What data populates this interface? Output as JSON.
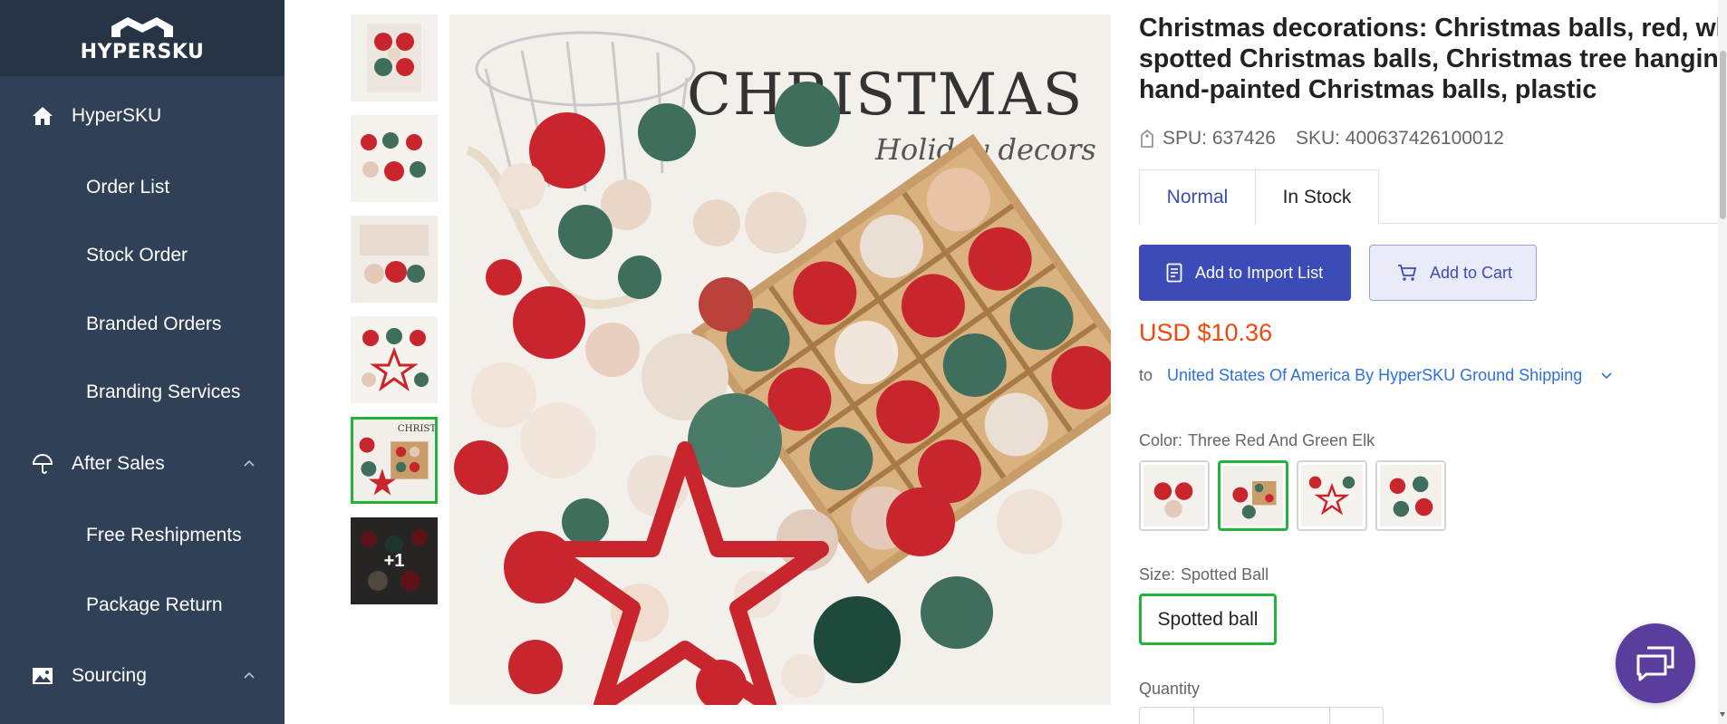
{
  "brand": {
    "name": "HYPERSKU"
  },
  "sidebar": {
    "home_group": {
      "label": "HyperSKU",
      "icon": "home-icon"
    },
    "home_items": [
      "Order List",
      "Stock Order",
      "Branded Orders",
      "Branding Services"
    ],
    "after_sales_group": {
      "label": "After Sales",
      "icon": "umbrella-icon"
    },
    "after_sales_items": [
      "Free Reshipments",
      "Package Return"
    ],
    "sourcing_group": {
      "label": "Sourcing",
      "icon": "image-icon"
    }
  },
  "gallery": {
    "more_count_label": "+1",
    "image_text": {
      "headline": "CHRISTMAS",
      "script": "Holiday decors"
    }
  },
  "product": {
    "title_line1": "Christmas decorations: Christmas balls, red, white",
    "title_line2": "spotted Christmas balls, Christmas tree hanging",
    "title_line3": "hand-painted Christmas balls, plastic",
    "spu": "SPU: 637426",
    "sku": "SKU: 400637426100012",
    "tabs": [
      "Normal",
      "In Stock"
    ],
    "add_to_import_label": "Add to Import List",
    "add_to_cart_label": "Add to Cart",
    "price": "USD $10.36",
    "ship_prefix": "to",
    "ship_destination": "United States Of America By HyperSKU Ground Shipping",
    "color_label": "Color:",
    "color_value": "Three Red And Green Elk",
    "size_label": "Size:",
    "size_value": "Spotted Ball",
    "size_option": "Spotted ball",
    "quantity_label": "Quantity"
  },
  "colors": {
    "sidebar_bg": "#304157",
    "logo_bg": "#263445",
    "primary": "#3b4cb8",
    "price": "#f2460d",
    "link": "#2f6fe0",
    "selected_border": "#23b33a",
    "chat_fab": "#5b3d9e"
  }
}
